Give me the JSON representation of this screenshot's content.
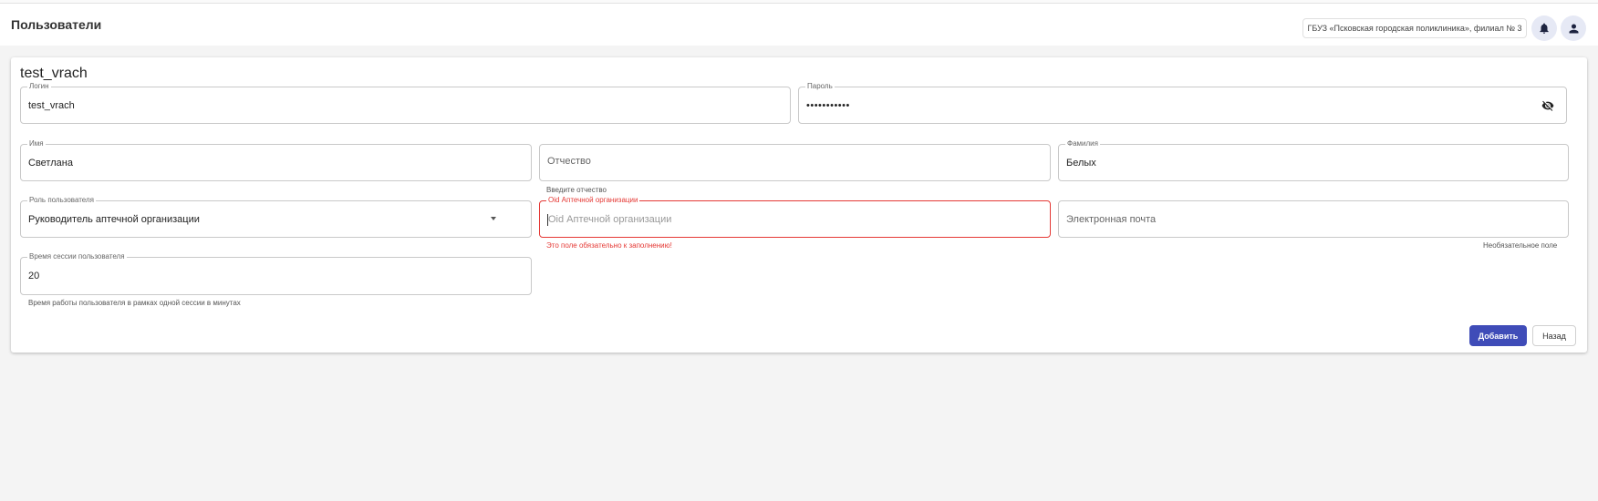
{
  "header": {
    "title": "Пользователи",
    "organization": "ГБУЗ «Псковская городская поликлиника», филиал № 3",
    "notifications_icon": "bell-icon",
    "user_icon": "user-icon"
  },
  "form": {
    "title": "test_vrach",
    "login": {
      "label": "Логин",
      "value": "test_vrach"
    },
    "password": {
      "label": "Пароль",
      "value": "•••••••••••",
      "toggle_icon": "eye-off-icon"
    },
    "first_name": {
      "label": "Имя",
      "value": "Светлана"
    },
    "patronymic": {
      "placeholder": "Отчество",
      "hint": "Введите отчество"
    },
    "last_name": {
      "label": "Фамилия",
      "value": "Белых"
    },
    "role": {
      "label": "Роль пользователя",
      "value": "Руководитель аптечной организации"
    },
    "pharmacy_oid": {
      "label": "Oid Аптечной организации",
      "placeholder": "Oid Аптечной организации",
      "error": "Это поле обязательно к заполнению!"
    },
    "email": {
      "placeholder": "Электронная почта",
      "hint": "Необязательное поле"
    },
    "session_time": {
      "label": "Время сессии пользователя",
      "value": "20",
      "hint": "Время работы пользователя в рамках одной сессии в минутах"
    }
  },
  "buttons": {
    "add": "Добавить",
    "back": "Назад"
  },
  "colors": {
    "primary": "#3f4cb8",
    "error": "#e53935",
    "background": "#f4f4f4"
  }
}
